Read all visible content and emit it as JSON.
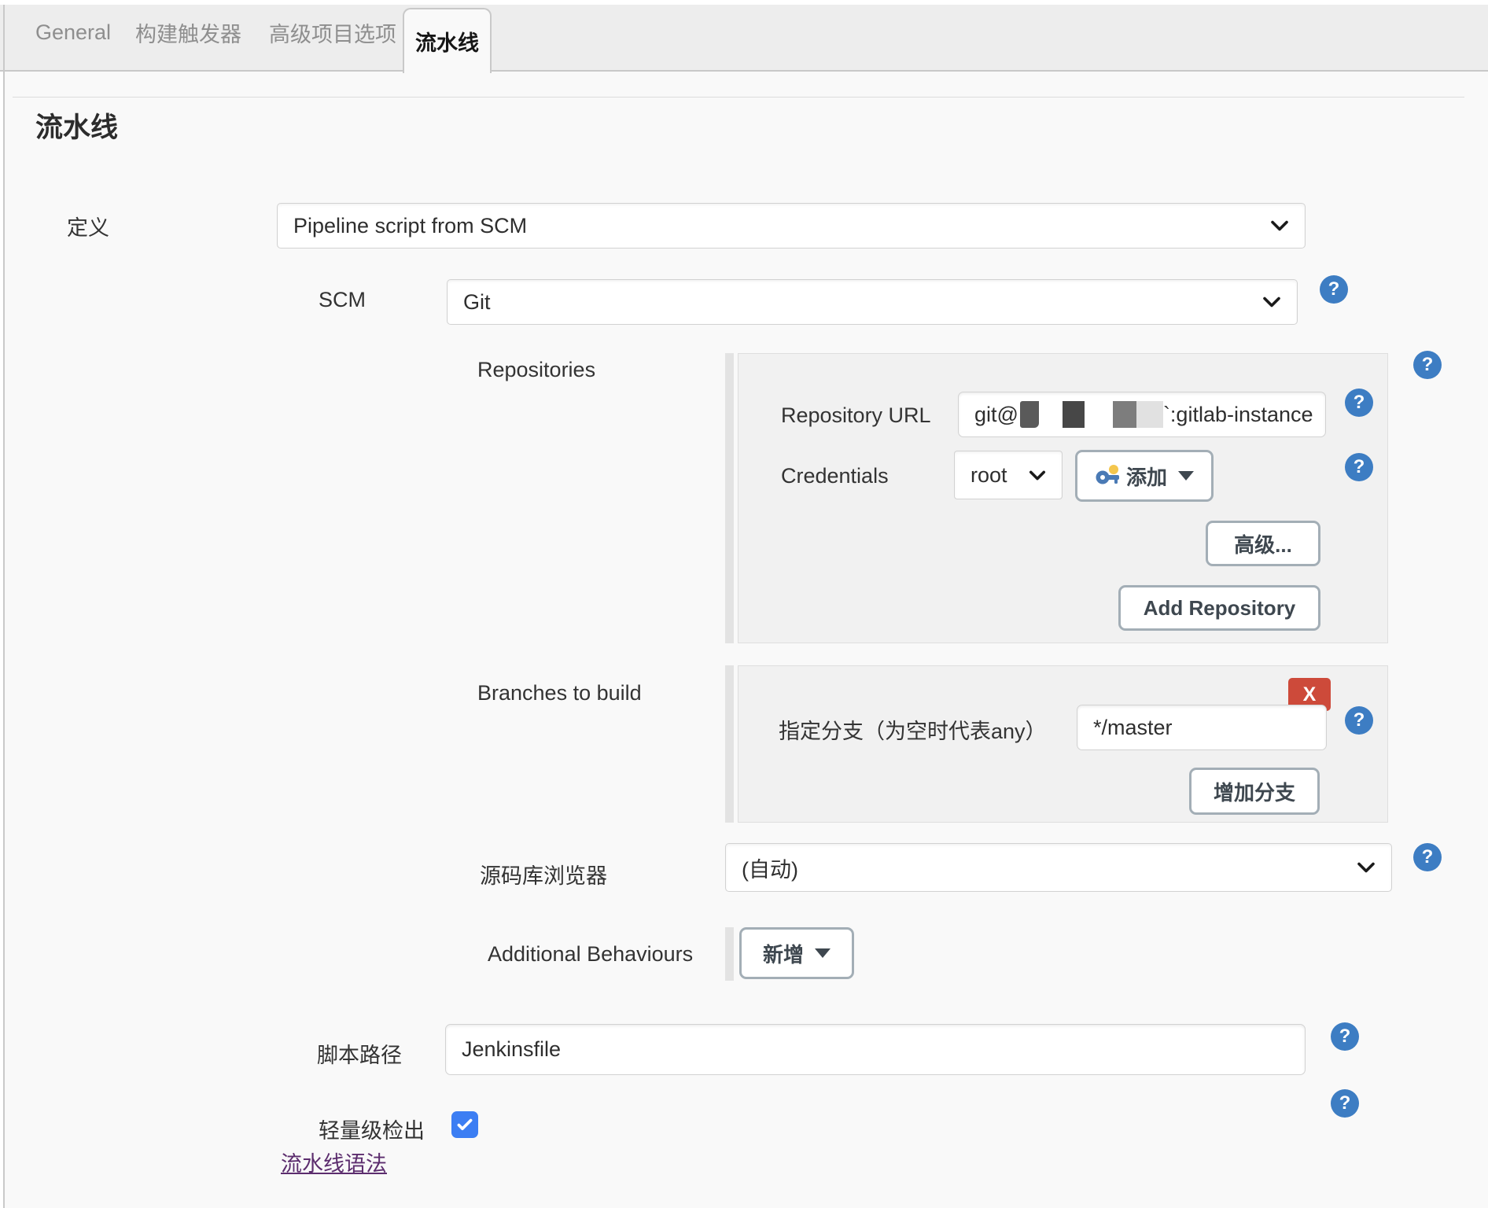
{
  "tabs": [
    {
      "label": "General",
      "active": false
    },
    {
      "label": "构建触发器",
      "active": false
    },
    {
      "label": "高级项目选项",
      "active": false
    },
    {
      "label": "流水线",
      "active": true
    }
  ],
  "page": {
    "title": "流水线"
  },
  "definition": {
    "label": "定义",
    "value": "Pipeline script from SCM"
  },
  "scm": {
    "label": "SCM",
    "value": "Git"
  },
  "repositories": {
    "section_label": "Repositories",
    "url_row": {
      "label": "Repository URL",
      "value_prefix": "git@",
      "value_suffix": "`:gitlab-instance",
      "redacted": true
    },
    "credentials_row": {
      "label": "Credentials",
      "selected": "root",
      "add_button_label": "添加"
    },
    "advanced_button_label": "高级...",
    "add_repository_button_label": "Add Repository"
  },
  "branches": {
    "section_label": "Branches to build",
    "remove_button_label": "X",
    "specifier": {
      "label": "指定分支（为空时代表any）",
      "value": "*/master"
    },
    "add_branch_button_label": "增加分支"
  },
  "repository_browser": {
    "label": "源码库浏览器",
    "value": "(自动)"
  },
  "additional_behaviours": {
    "label": "Additional Behaviours",
    "add_button_label": "新增"
  },
  "script_path": {
    "label": "脚本路径",
    "value": "Jenkinsfile"
  },
  "lightweight_checkout": {
    "label": "轻量级检出",
    "checked": true
  },
  "pipeline_syntax": {
    "link_label": "流水线语法"
  },
  "icons": {
    "help_glyph": "?"
  },
  "colors": {
    "help_blue": "#3d7dc3",
    "danger_red": "#cd4a3a",
    "checkbox_blue": "#3c7ef3",
    "link_purple": "#5c2d6e"
  }
}
